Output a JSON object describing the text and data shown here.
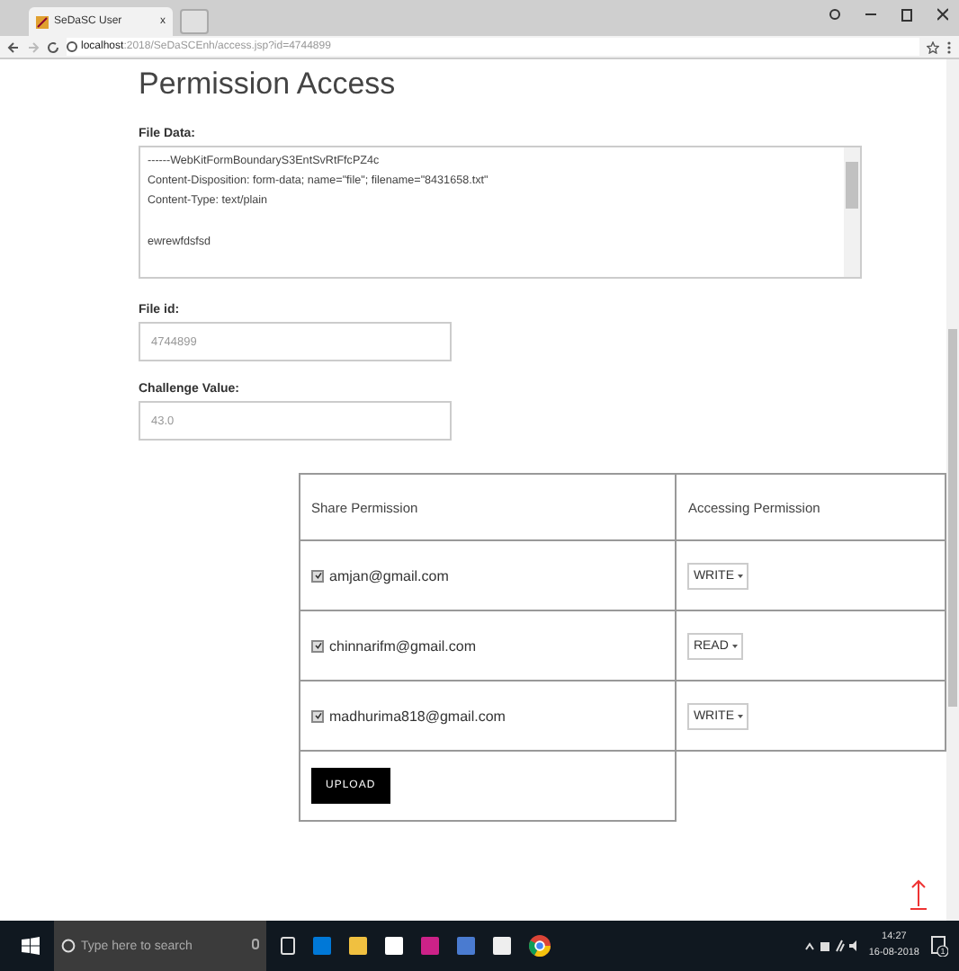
{
  "browser": {
    "tab_title": "SeDaSC User",
    "tab_close": "x",
    "url_host": "localhost",
    "url_path": ":2018/SeDaSCEnh/access.jsp?id=4744899"
  },
  "page": {
    "title": "Permission Access",
    "file_data": {
      "label": "File Data:",
      "paragraphs": [
        [
          "------WebKitFormBoundaryS3EntSvRtFfcPZ4c",
          "Content-Disposition: form-data; name=\"file\"; filename=\"8431658.txt\"",
          "Content-Type: text/plain"
        ],
        [
          "ewrewfdsfsd"
        ]
      ]
    },
    "file_id": {
      "label": "File id:",
      "placeholder": "4744899"
    },
    "challenge": {
      "label": "Challenge Value:",
      "placeholder": "43.0"
    },
    "table": {
      "columns": [
        "Share Permission",
        "Accessing Permission"
      ],
      "rows": [
        {
          "email": "amjan@gmail.com",
          "checked": true,
          "permission": "WRITE"
        },
        {
          "email": "chinnarifm@gmail.com",
          "checked": true,
          "permission": "READ"
        },
        {
          "email": "madhurima818@gmail.com",
          "checked": true,
          "permission": "WRITE"
        }
      ],
      "button": "UPLOAD"
    }
  },
  "taskbar": {
    "search_placeholder": "Type here to search",
    "time": "14:27",
    "date": "16-08-2018",
    "notifications": "1"
  }
}
